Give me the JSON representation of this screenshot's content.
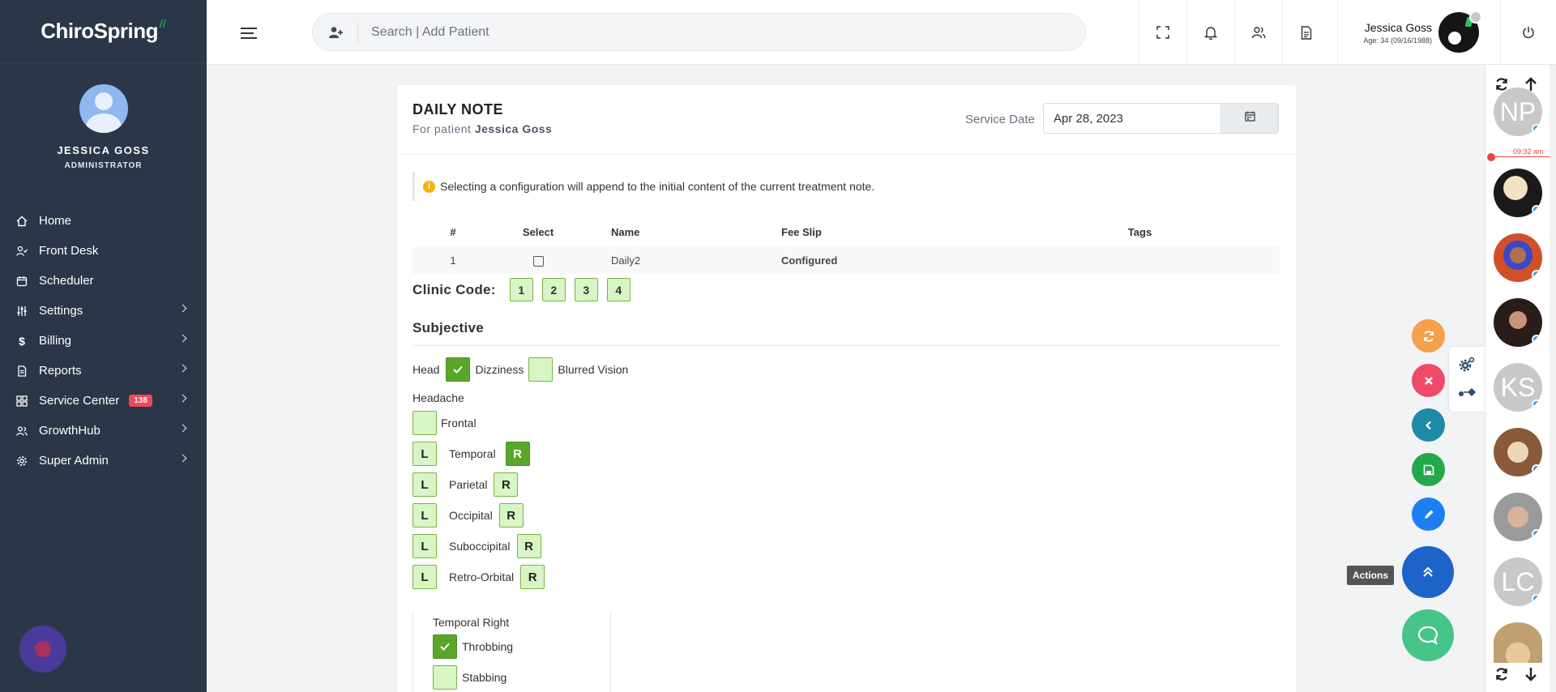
{
  "brand": {
    "name": "ChiroSpring"
  },
  "profile": {
    "name": "JESSICA GOSS",
    "role": "ADMINISTRATOR"
  },
  "nav": [
    {
      "label": "Home",
      "icon": "home-icon"
    },
    {
      "label": "Front Desk",
      "icon": "user-check-icon"
    },
    {
      "label": "Scheduler",
      "icon": "calendar-icon"
    },
    {
      "label": "Settings",
      "icon": "sliders-icon",
      "expandable": true
    },
    {
      "label": "Billing",
      "icon": "dollar-icon",
      "expandable": true
    },
    {
      "label": "Reports",
      "icon": "report-icon",
      "expandable": true
    },
    {
      "label": "Service Center",
      "icon": "grid-icon",
      "expandable": true,
      "badge": "138"
    },
    {
      "label": "GrowthHub",
      "icon": "users-icon",
      "expandable": true
    },
    {
      "label": "Super Admin",
      "icon": "gear-icon",
      "expandable": true
    }
  ],
  "header": {
    "search_placeholder": "Search | Add Patient",
    "user_name": "Jessica Goss",
    "user_age": "Age: 34 (09/16/1988)"
  },
  "note": {
    "title": "DAILY NOTE",
    "for_patient_prefix": "For patient",
    "patient_name": "Jessica Goss",
    "service_date_label": "Service Date",
    "service_date": "Apr 28, 2023",
    "info": "Selecting a configuration will append to the initial content of the current treatment note."
  },
  "config_table": {
    "headers": [
      "#",
      "Select",
      "Name",
      "Fee Slip",
      "Tags"
    ],
    "rows": [
      {
        "num": "1",
        "name": "Daily2",
        "fee_slip": "Configured",
        "tags": ""
      }
    ]
  },
  "clinic_code": {
    "label": "Clinic Code:",
    "codes": [
      "1",
      "2",
      "3",
      "4"
    ]
  },
  "subjective": {
    "title": "Subjective",
    "head_label": "Head",
    "dizziness": "Dizziness",
    "blurred_vision": "Blurred Vision",
    "headache_label": "Headache",
    "frontal": "Frontal",
    "left": "L",
    "right": "R",
    "regions": [
      "Temporal",
      "Parietal",
      "Occipital",
      "Suboccipital",
      "Retro-Orbital"
    ],
    "temporal_right_title": "Temporal Right",
    "throbbing": "Throbbing",
    "stabbing": "Stabbing"
  },
  "actions_tooltip": "Actions",
  "rail": {
    "np_initials": "NP",
    "ks_initials": "KS",
    "lc_initials": "LC",
    "time_label": "09:32 am"
  },
  "colors": {
    "sidebar": "#2b3748",
    "toggle_on": "#5aa62a",
    "toggle_off": "#d8f5c6",
    "badge": "#ef4858"
  }
}
